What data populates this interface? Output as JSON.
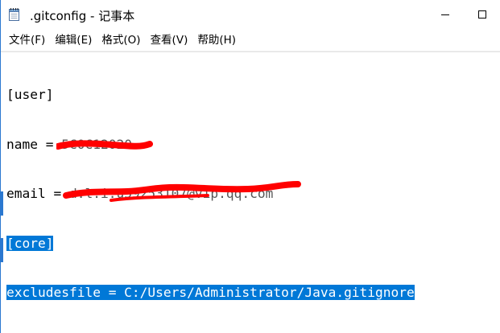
{
  "window": {
    "title": ".gitconfig - 记事本",
    "icons": {
      "app": "notepad-icon",
      "minimize": "minimize-icon",
      "maximize": "maximize-icon"
    }
  },
  "menu": {
    "items": [
      {
        "label": "文件(F)"
      },
      {
        "label": "编辑(E)"
      },
      {
        "label": "格式(O)"
      },
      {
        "label": "查看(V)"
      },
      {
        "label": "帮助(H)"
      }
    ]
  },
  "editor": {
    "lines": {
      "l1": "[user]",
      "l2_key": "name = ",
      "l2_value": "5C0C12020",
      "l3_key": "email = ",
      "l3_value": "d.l.i.u59253107@vip.qq.com",
      "l4": "[core]",
      "l5": "excludesfile = C:/Users/Administrator/Java.gitignore"
    },
    "selection_color": "#0078d7",
    "redaction_color": "#ff0000"
  }
}
